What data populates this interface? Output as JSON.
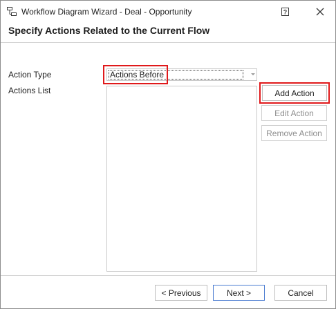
{
  "window": {
    "title": "Workflow Diagram Wizard - Deal - Opportunity",
    "help_glyph": "?",
    "close_glyph": "✕"
  },
  "header": {
    "title": "Specify Actions Related to the Current Flow"
  },
  "form": {
    "action_type_label": "Action Type",
    "action_type_value": "Actions Before",
    "actions_list_label": "Actions List",
    "actions_list_items": []
  },
  "side_buttons": {
    "add": "Add Action",
    "edit": "Edit Action",
    "remove": "Remove Action"
  },
  "footer": {
    "previous": "< Previous",
    "next": "Next >",
    "cancel": "Cancel"
  },
  "colors": {
    "highlight": "#e0191b",
    "default_button_border": "#4a7bd0"
  },
  "icons": {
    "app": "workflow-diagram-icon",
    "help": "help-icon",
    "close": "close-icon",
    "dropdown": "chevron-down-icon"
  }
}
